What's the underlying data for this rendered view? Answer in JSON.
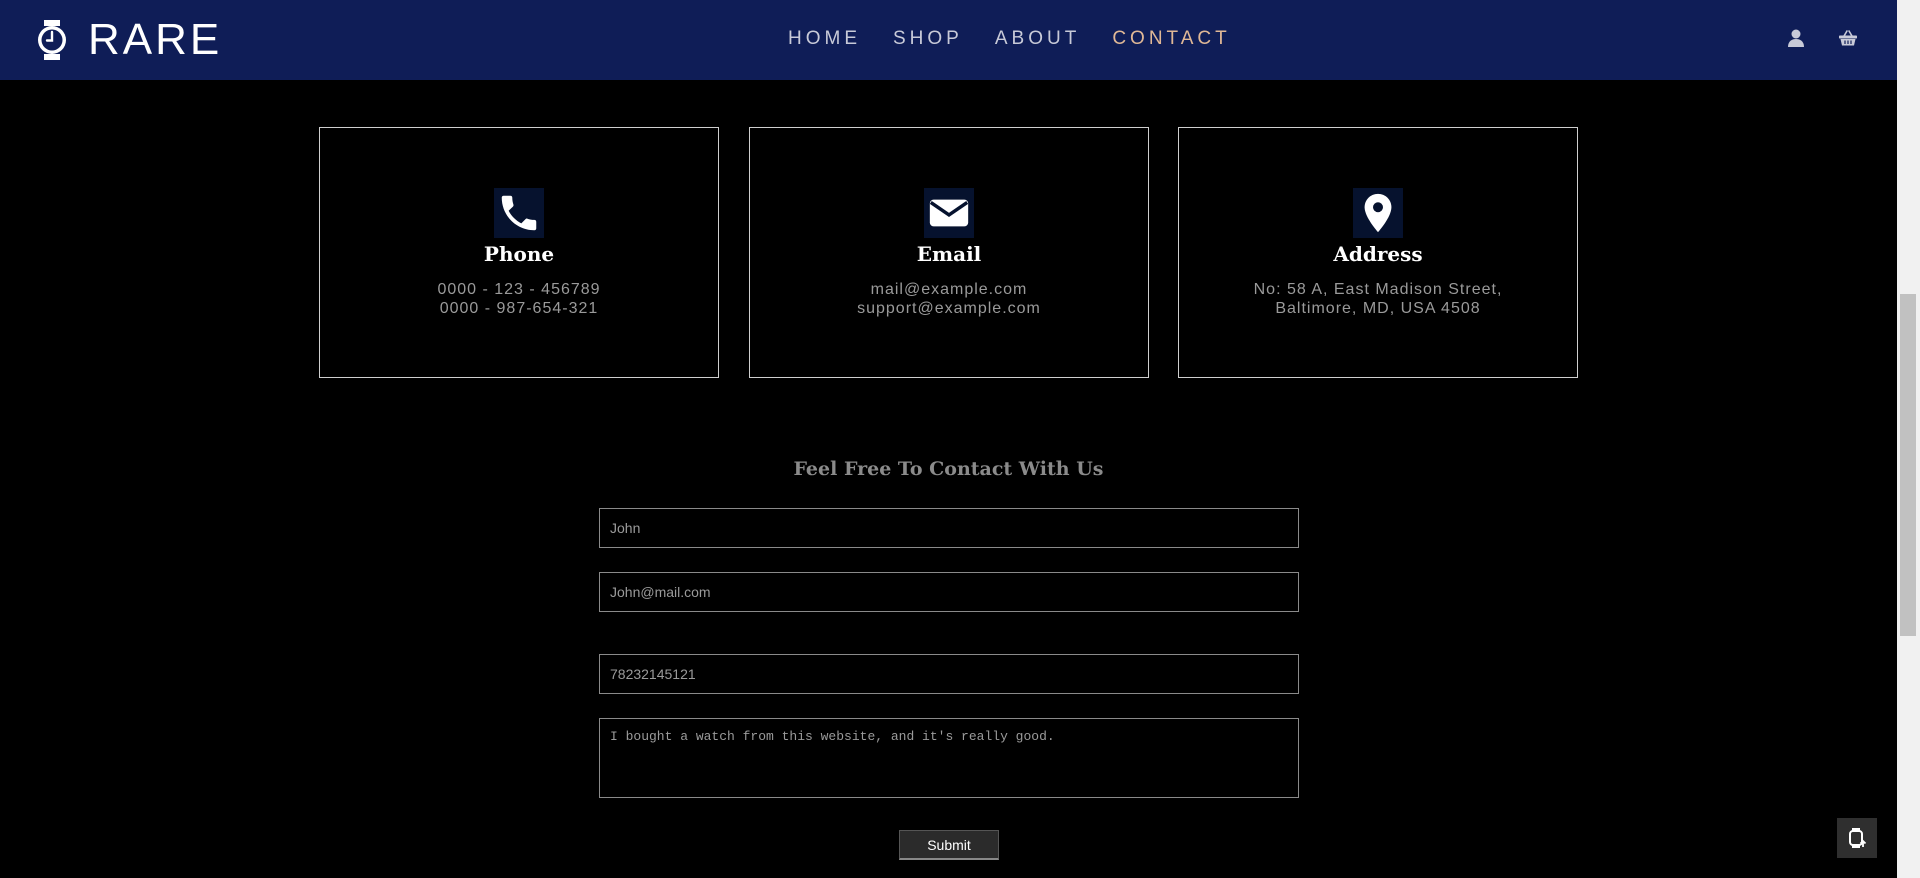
{
  "brand": {
    "name": "RARE",
    "icon": "watch-icon"
  },
  "nav": {
    "links": [
      {
        "label": "HOME",
        "active": false
      },
      {
        "label": "SHOP",
        "active": false
      },
      {
        "label": "ABOUT",
        "active": false
      },
      {
        "label": "CONTACT",
        "active": true
      }
    ],
    "icons": [
      "user-icon",
      "basket-icon"
    ]
  },
  "cards": [
    {
      "icon": "phone-icon",
      "title": "Phone",
      "lines": [
        "0000 - 123 - 456789",
        "0000 - 987-654-321"
      ]
    },
    {
      "icon": "envelope-icon",
      "title": "Email",
      "lines": [
        "mail@example.com",
        "support@example.com"
      ]
    },
    {
      "icon": "map-pin-icon",
      "title": "Address",
      "lines": [
        "No: 58 A, East Madison Street,",
        "Baltimore, MD, USA 4508"
      ]
    }
  ],
  "form": {
    "title": "Feel Free To Contact With Us",
    "name_value": "John",
    "email_value": "John@mail.com",
    "phone_value": "78232145121",
    "message_value": "I bought a watch from this website, and it's really good.",
    "submit_label": "Submit"
  },
  "colors": {
    "navbar": "#0f1d57",
    "active_link": "#e0b896",
    "background": "#000000",
    "icon_tile": "#06122e"
  },
  "floating_button": {
    "icon": "watch-upload-icon"
  }
}
